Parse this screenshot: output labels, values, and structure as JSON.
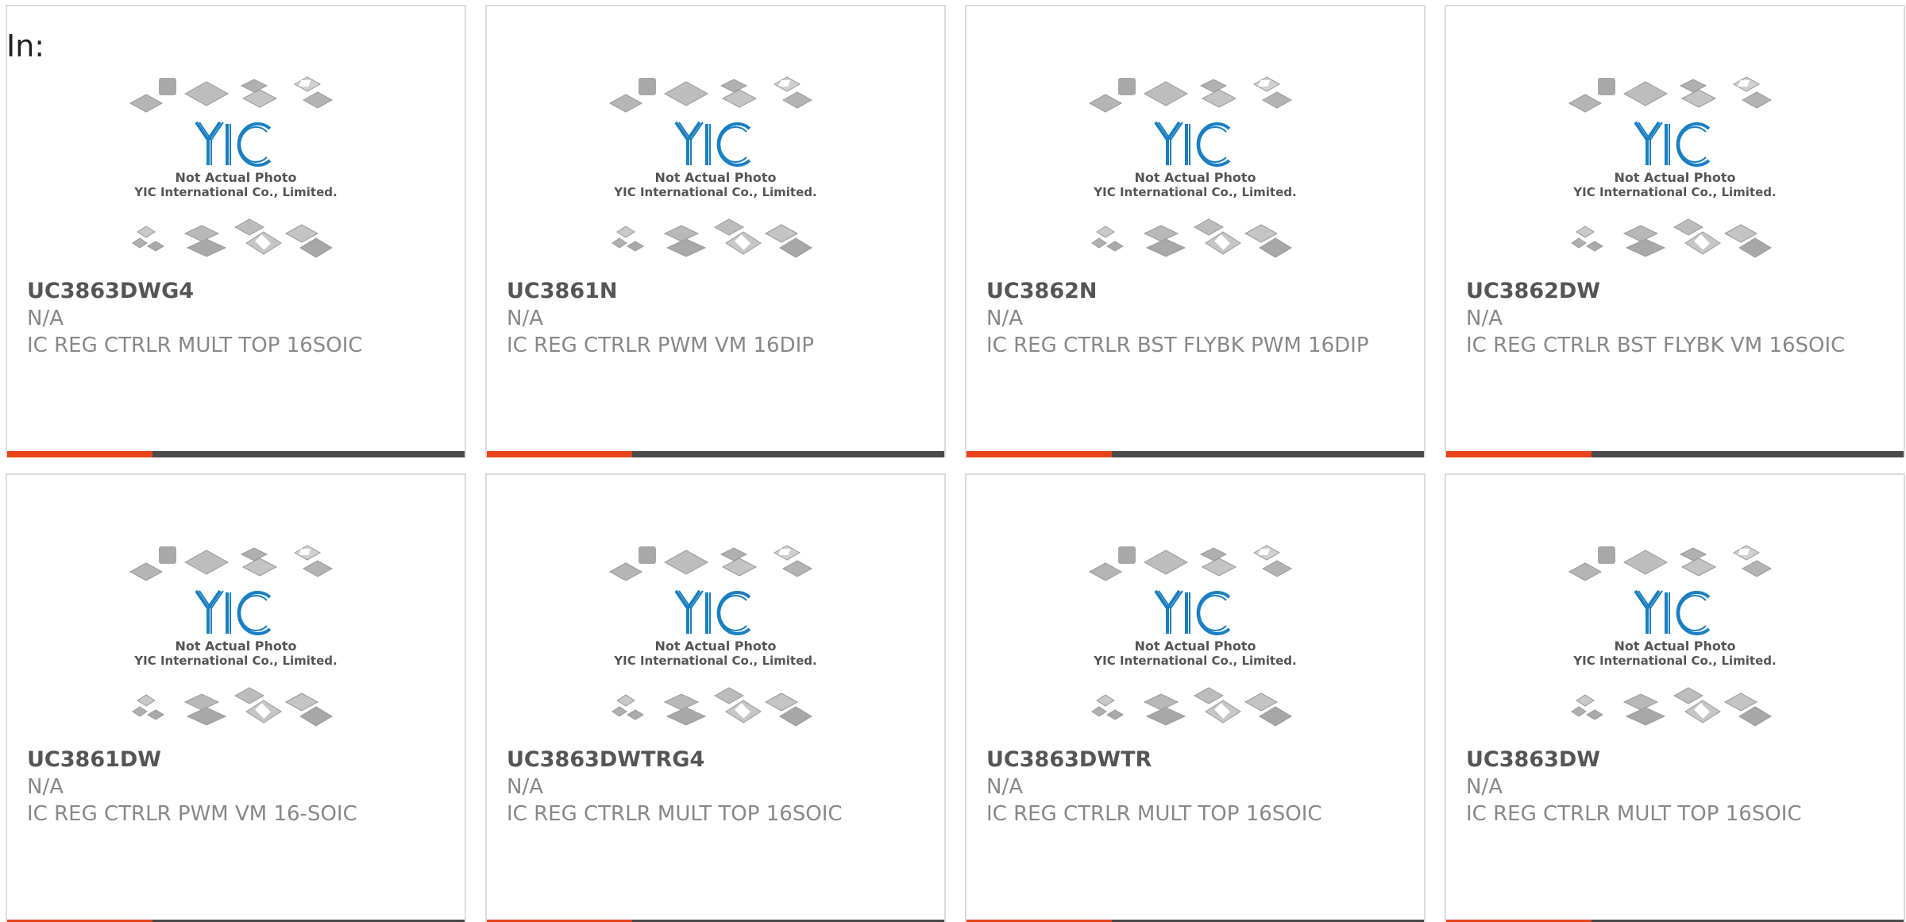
{
  "header": {
    "label": "In:"
  },
  "colors": {
    "accent": "#e8431b",
    "bar": "#4a4a4a",
    "logo": "#1a7fc1"
  },
  "image": {
    "caption_line1": "Not Actual Photo",
    "caption_line2": "YIC International Co., Limited."
  },
  "products": [
    {
      "part": "UC3863DWG4",
      "manufacturer": "N/A",
      "description": "IC REG CTRLR MULT TOP 16SOIC"
    },
    {
      "part": "UC3861N",
      "manufacturer": "N/A",
      "description": "IC REG CTRLR PWM VM 16DIP"
    },
    {
      "part": "UC3862N",
      "manufacturer": "N/A",
      "description": "IC REG CTRLR BST FLYBK PWM 16DIP"
    },
    {
      "part": "UC3862DW",
      "manufacturer": "N/A",
      "description": "IC REG CTRLR BST FLYBK VM 16SOIC"
    },
    {
      "part": "UC3861DW",
      "manufacturer": "N/A",
      "description": "IC REG CTRLR PWM VM 16-SOIC"
    },
    {
      "part": "UC3863DWTRG4",
      "manufacturer": "N/A",
      "description": "IC REG CTRLR MULT TOP 16SOIC"
    },
    {
      "part": "UC3863DWTR",
      "manufacturer": "N/A",
      "description": "IC REG CTRLR MULT TOP 16SOIC"
    },
    {
      "part": "UC3863DW",
      "manufacturer": "N/A",
      "description": "IC REG CTRLR MULT TOP 16SOIC"
    }
  ]
}
